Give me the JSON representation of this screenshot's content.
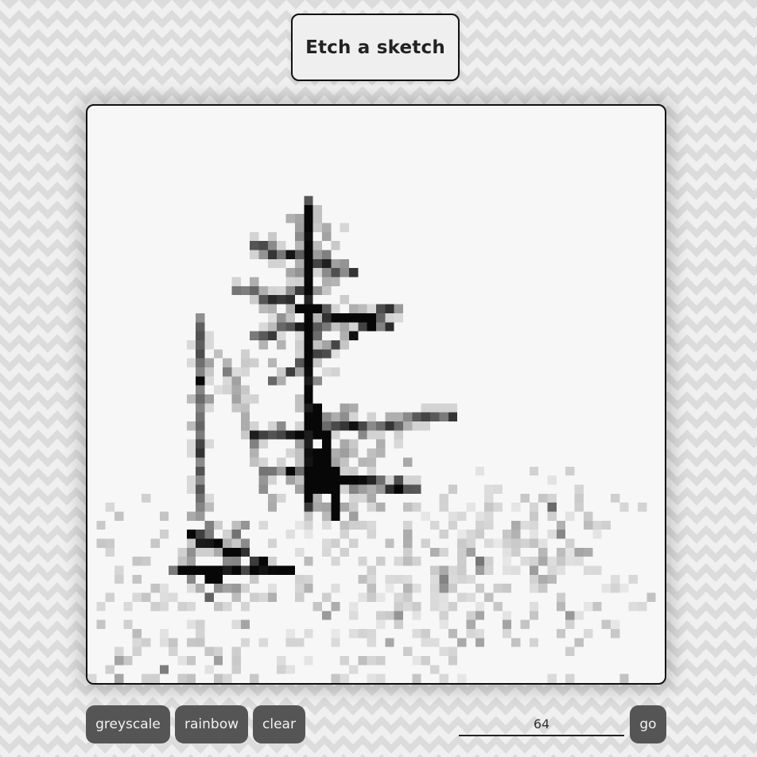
{
  "header": {
    "title": "Etch a sketch"
  },
  "controls": {
    "greyscale_label": "greyscale",
    "rainbow_label": "rainbow",
    "clear_label": "clear",
    "grid_size_value": "64",
    "go_label": "go"
  },
  "colors": {
    "button_bg": "#555555",
    "button_text": "#f2f2f2",
    "board_bg": "#f7f7f7",
    "page_bg": "#f0f0f0"
  },
  "sketch": {
    "grid_size": 64,
    "description_shapes": "greyscale pixel drawing"
  }
}
